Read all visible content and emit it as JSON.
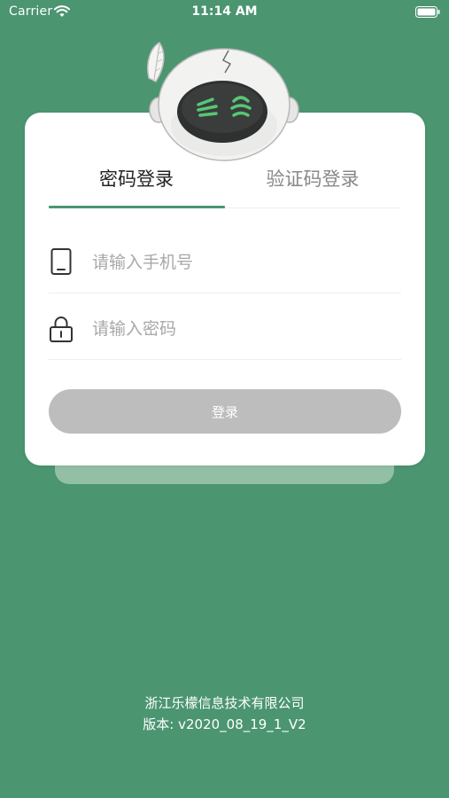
{
  "status_bar": {
    "carrier": "Carrier",
    "time": "11:14 AM"
  },
  "tabs": [
    {
      "label": "密码登录",
      "active": true
    },
    {
      "label": "验证码登录",
      "active": false
    }
  ],
  "form": {
    "phone": {
      "placeholder": "请输入手机号",
      "value": "",
      "icon": "phone-icon"
    },
    "password": {
      "placeholder": "请输入密码",
      "value": "",
      "icon": "lock-icon"
    },
    "login_label": "登录"
  },
  "footer": {
    "company": "浙江乐檬信息技术有限公司",
    "version": "版本: v2020_08_19_1_V2"
  },
  "colors": {
    "background": "#4b9571",
    "accent": "#4b9571",
    "button_disabled": "#bdbdbd",
    "robot_eyes": "#56c774"
  }
}
